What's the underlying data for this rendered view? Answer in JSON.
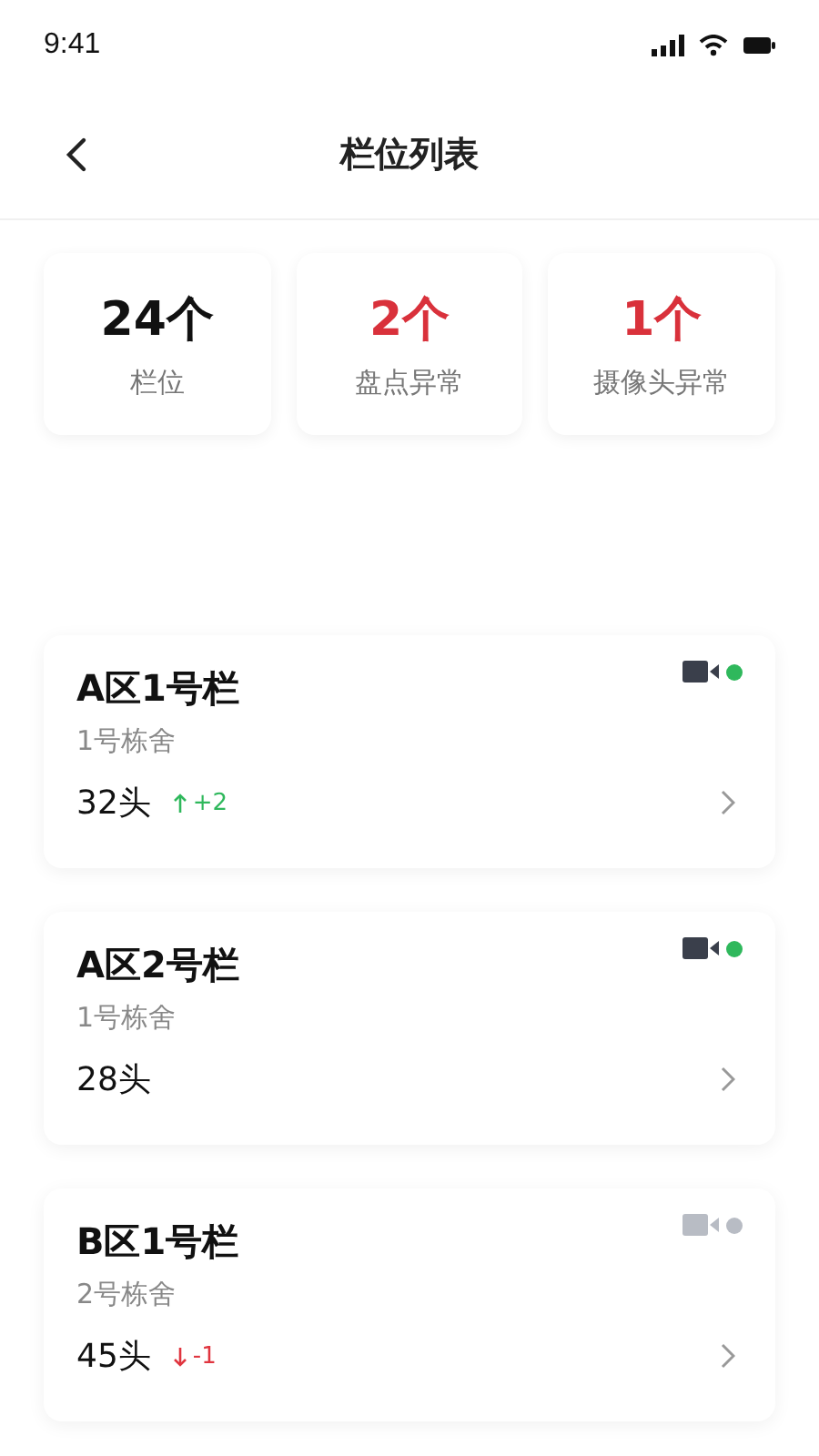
{
  "status_bar": {
    "time": "9:41"
  },
  "header": {
    "title": "栏位列表"
  },
  "stats": [
    {
      "value": "24个",
      "label": "栏位",
      "alert": false
    },
    {
      "value": "2个",
      "label": "盘点异常",
      "alert": true
    },
    {
      "value": "1个",
      "label": "摄像头异常",
      "alert": true
    }
  ],
  "pens": [
    {
      "name": "A区1号栏",
      "barn": "1号栋舍",
      "count": "32头",
      "camera_online": true,
      "change": {
        "rising": true,
        "text": "+2"
      }
    },
    {
      "name": "A区2号栏",
      "barn": "1号栋舍",
      "count": "28头",
      "camera_online": true
    },
    {
      "name": "B区1号栏",
      "barn": "2号栋舍",
      "count": "45头",
      "camera_online": false,
      "change": {
        "rising": false,
        "text": "-1"
      }
    }
  ]
}
